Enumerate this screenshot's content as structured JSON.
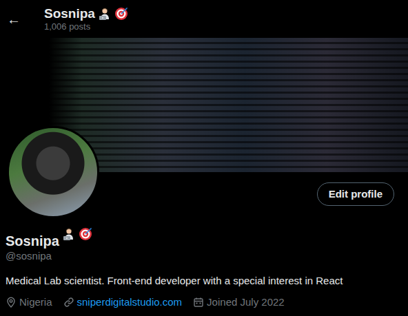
{
  "header": {
    "back": "←",
    "name": "Sosnipa",
    "posts": "1,006 posts"
  },
  "profile": {
    "name": "Sosnipa",
    "handle": "@sosnipa",
    "bio": "Medical Lab scientist. Front-end developer with a special interest in React",
    "edit_button": "Edit profile",
    "meta": [
      {
        "kind": "location",
        "text": "Nigeria"
      },
      {
        "kind": "link",
        "text": "sniperdigitalstudio.com"
      },
      {
        "kind": "joined",
        "text": "Joined July 2022"
      }
    ]
  }
}
